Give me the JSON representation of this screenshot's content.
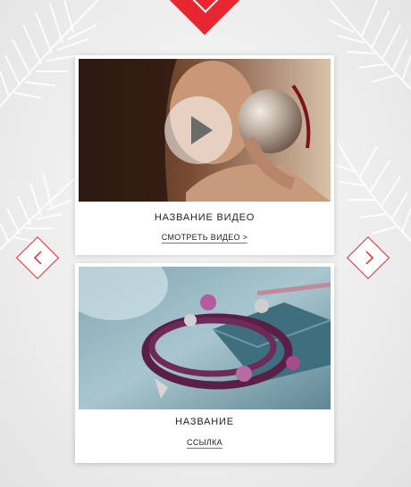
{
  "cards": [
    {
      "title": "НАЗВАНИЕ ВИДЕО",
      "link": "СМОТРЕТЬ ВИДЕО >",
      "media": "video-thumbnail-woman-ornament",
      "play_icon": "play-icon"
    },
    {
      "title": "НАЗВАНИЕ",
      "link": "ССЫЛКА",
      "media": "photo-bracelet-charms"
    }
  ],
  "nav": {
    "prev_icon": "chevron-left-icon",
    "next_icon": "chevron-right-icon"
  },
  "colors": {
    "accent": "#e8262f",
    "card_bg": "#ffffff",
    "page_bg": "#eeeeee"
  }
}
